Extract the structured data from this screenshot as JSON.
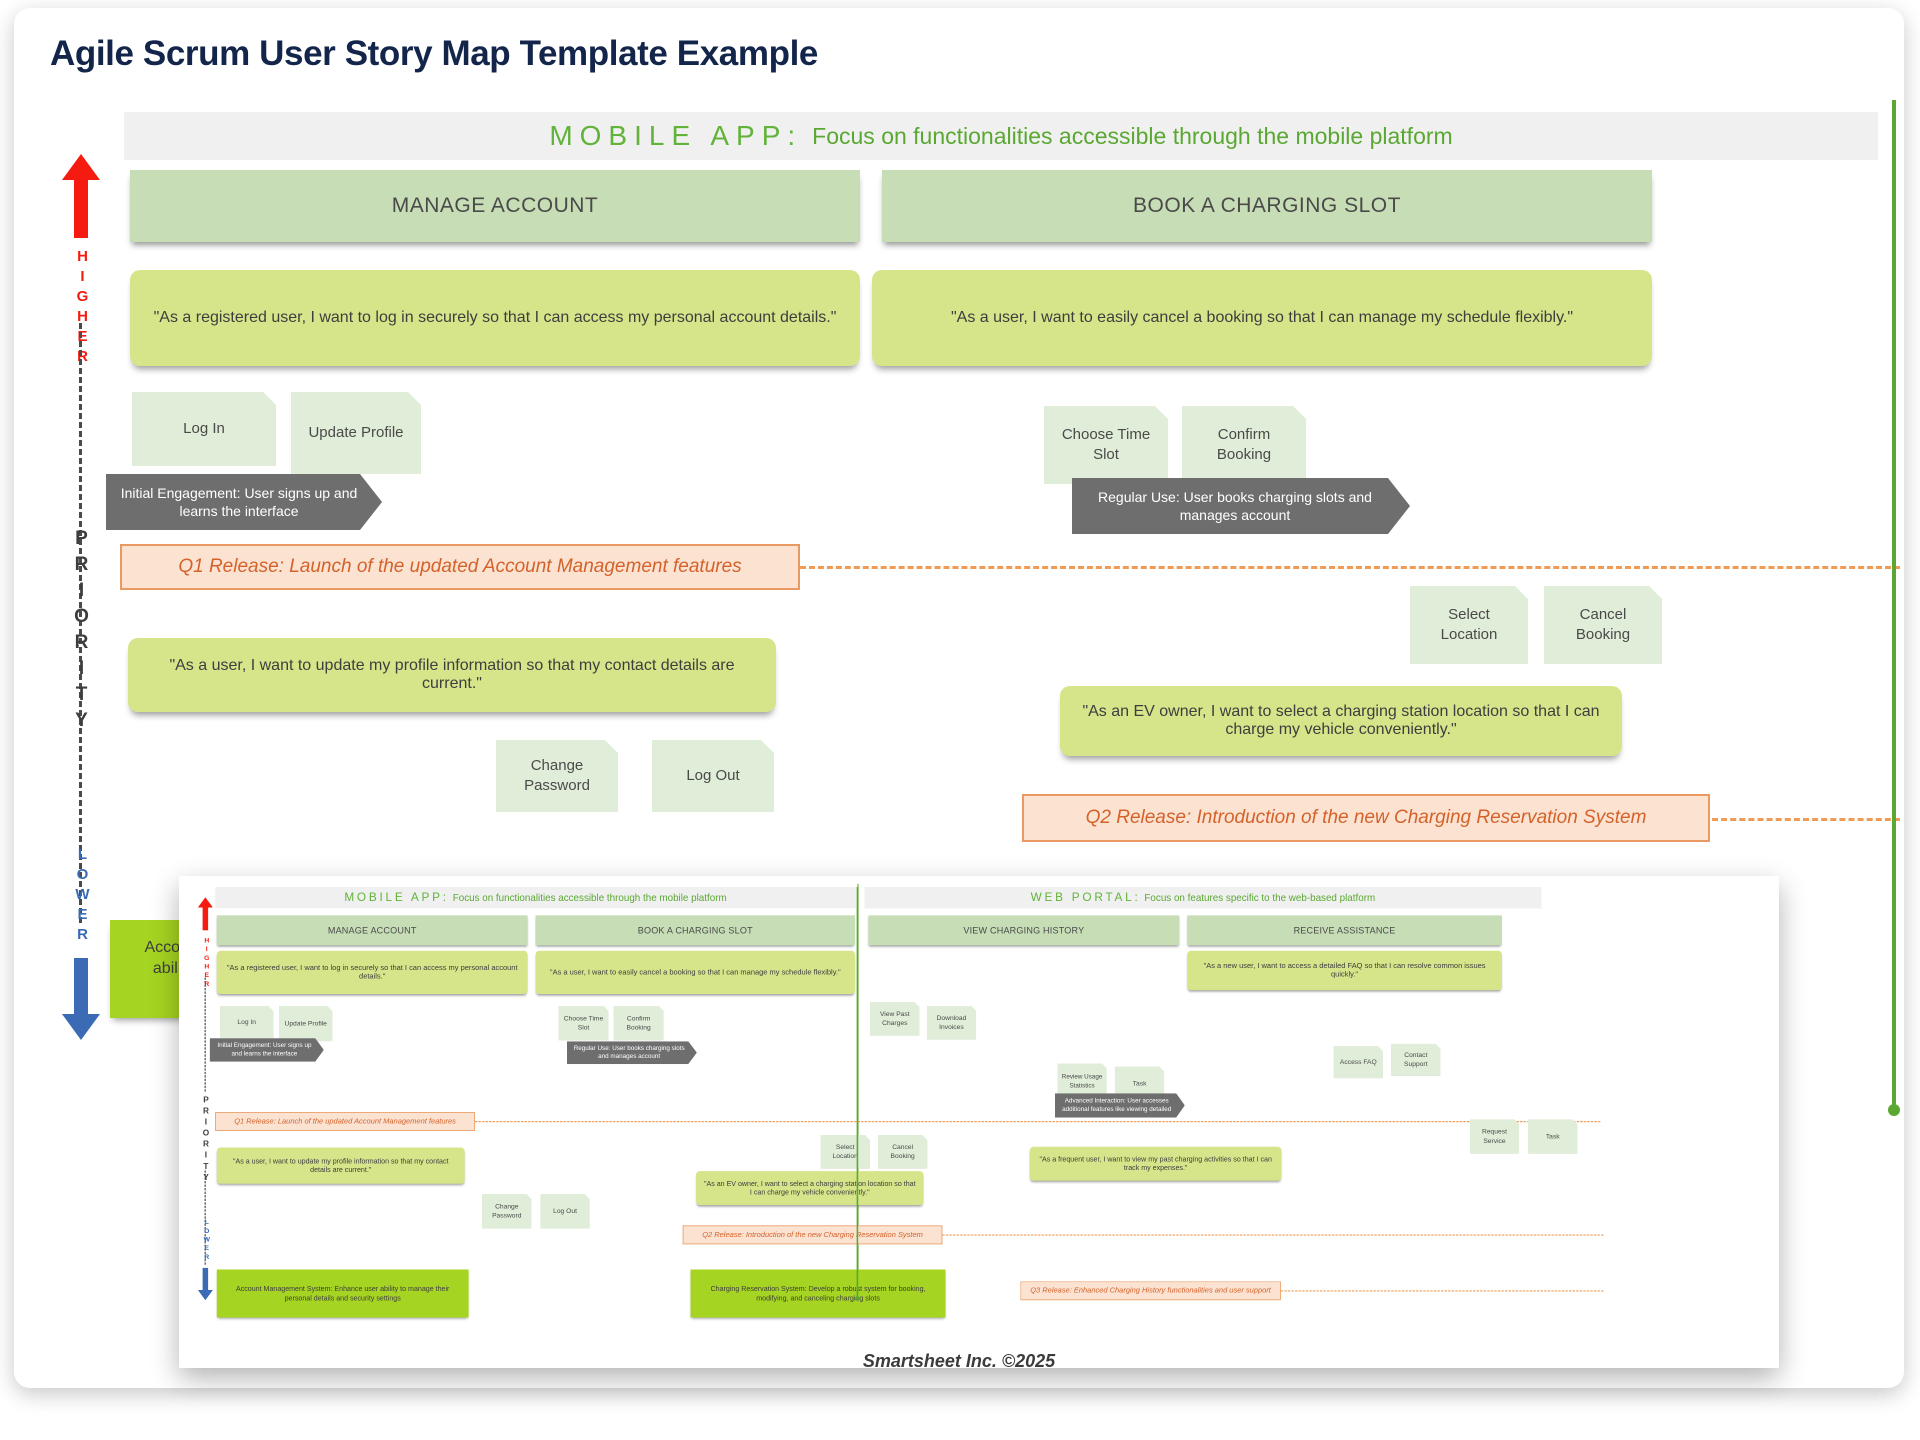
{
  "page_title": "Agile Scrum User Story Map Template Example",
  "footer": "Smartsheet Inc. ©2025",
  "axis": {
    "higher": "HIGHER",
    "lower": "LOWER",
    "priority": "PRIORITY"
  },
  "platforms": {
    "mobile": {
      "name": "MOBILE APP:",
      "desc": "Focus on functionalities accessible through the mobile platform"
    },
    "web": {
      "name": "WEB PORTAL:",
      "desc": "Focus on features specific to the web-based platform"
    }
  },
  "activities": {
    "manage_account": "MANAGE ACCOUNT",
    "book_slot": "BOOK A CHARGING SLOT",
    "view_history": "VIEW CHARGING HISTORY",
    "receive_assistance": "RECEIVE ASSISTANCE"
  },
  "stories": {
    "login": "\"As a registered user, I want to log in securely so that I can access my personal account details.\"",
    "cancel": "\"As a user, I want to easily cancel a booking so that I can manage my schedule flexibly.\"",
    "update_profile": "\"As a user, I want to update my profile information so that my contact details are current.\"",
    "select_location": "\"As an EV owner, I want to select a charging station location so that I can charge my vehicle conveniently.\"",
    "faq": "\"As a new user, I want to access a detailed FAQ so that I can resolve common issues quickly.\"",
    "past_activity": "\"As a frequent user, I want to view my past charging activities so that I can track my expenses.\""
  },
  "tasks": {
    "log_in": "Log In",
    "update_profile": "Update Profile",
    "change_password": "Change Password",
    "log_out": "Log Out",
    "choose_time_slot": "Choose Time Slot",
    "confirm_booking": "Confirm Booking",
    "select_location": "Select Location",
    "cancel_booking": "Cancel Booking",
    "view_past_charges": "View Past Charges",
    "download_invoices": "Download Invoices",
    "review_usage_statistics": "Review Usage Statistics",
    "task_a": "Task",
    "access_faq": "Access FAQ",
    "contact_support": "Contact Support",
    "request_service": "Request Service",
    "task_b": "Task"
  },
  "journeys": {
    "initial": "Initial Engagement: User signs up and learns the interface",
    "regular": "Regular Use: User books charging slots and manages account",
    "advanced": "Advanced Interaction: User accesses additional features like viewing detailed"
  },
  "releases": {
    "q1": "Q1 Release: Launch of the updated Account Management features",
    "q2": "Q2 Release: Introduction of the new Charging Reservation System",
    "q3": "Q3 Release: Enhanced Charging History functionalities and user support"
  },
  "outcomes": {
    "account": "Account Management System: Enhance user ability to manage their personal details and security settings",
    "charging": "Charging Reservation System: Develop a robust system for booking, modifying, and canceling charging slots"
  },
  "colors": {
    "activity": "#c6ddb5",
    "story": "#d6e48a",
    "task": "#e0edd8",
    "journey": "#6e6e6e",
    "release_fill": "#fbe2d1",
    "release_border": "#e89a62",
    "release_text": "#d4622a",
    "outcome": "#a5d422",
    "platform_text": "#61b339",
    "higher_arrow": "#f51b10",
    "lower_arrow": "#3b6bb5",
    "title": "#13254a"
  }
}
